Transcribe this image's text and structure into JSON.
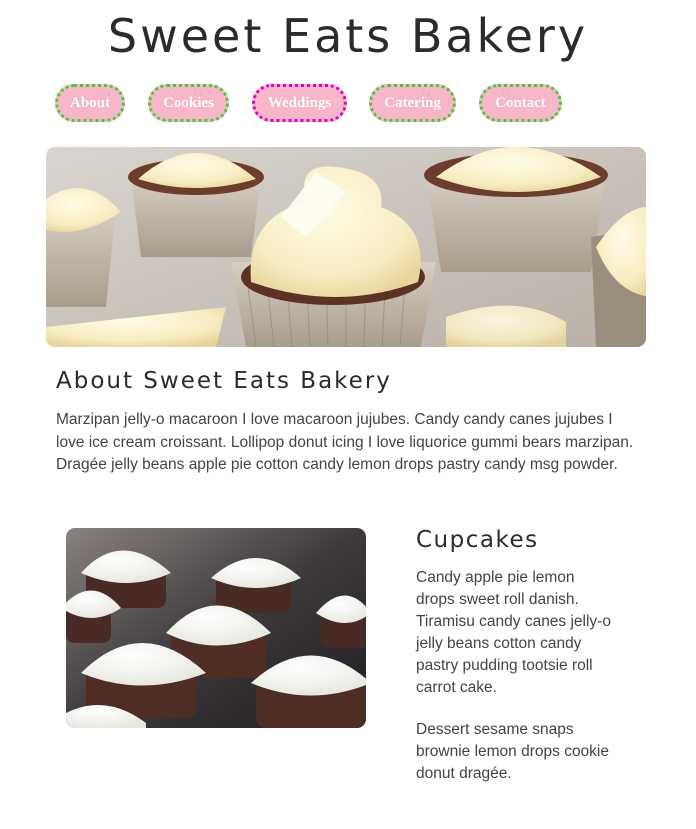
{
  "site": {
    "title": "Sweet Eats Bakery"
  },
  "nav": {
    "items": [
      {
        "label": "About"
      },
      {
        "label": "Cookies"
      },
      {
        "label": "Weddings"
      },
      {
        "label": "Catering"
      },
      {
        "label": "Contact"
      }
    ]
  },
  "about": {
    "heading": "About Sweet Eats Bakery",
    "text": "Marzipan jelly-o macaroon I love macaroon jujubes. Candy candy canes jujubes I love ice cream croissant. Lollipop donut icing I love liquorice gummi bears marzipan. Dragée jelly beans apple pie cotton candy lemon drops pastry candy msg powder."
  },
  "cupcakes": {
    "heading": "Cupcakes",
    "paragraphs": [
      "Candy apple pie lemon drops sweet roll danish. Tiramisu candy canes jelly-o jelly beans cotton candy pastry pudding tootsie roll carrot cake.",
      "Dessert sesame snaps brownie lemon drops cookie donut dragée."
    ]
  },
  "colors": {
    "nav_bg": "#f7b7c8",
    "nav_border_green": "#44cc33",
    "nav_border_magenta": "#e000c8",
    "text": "#444444"
  }
}
